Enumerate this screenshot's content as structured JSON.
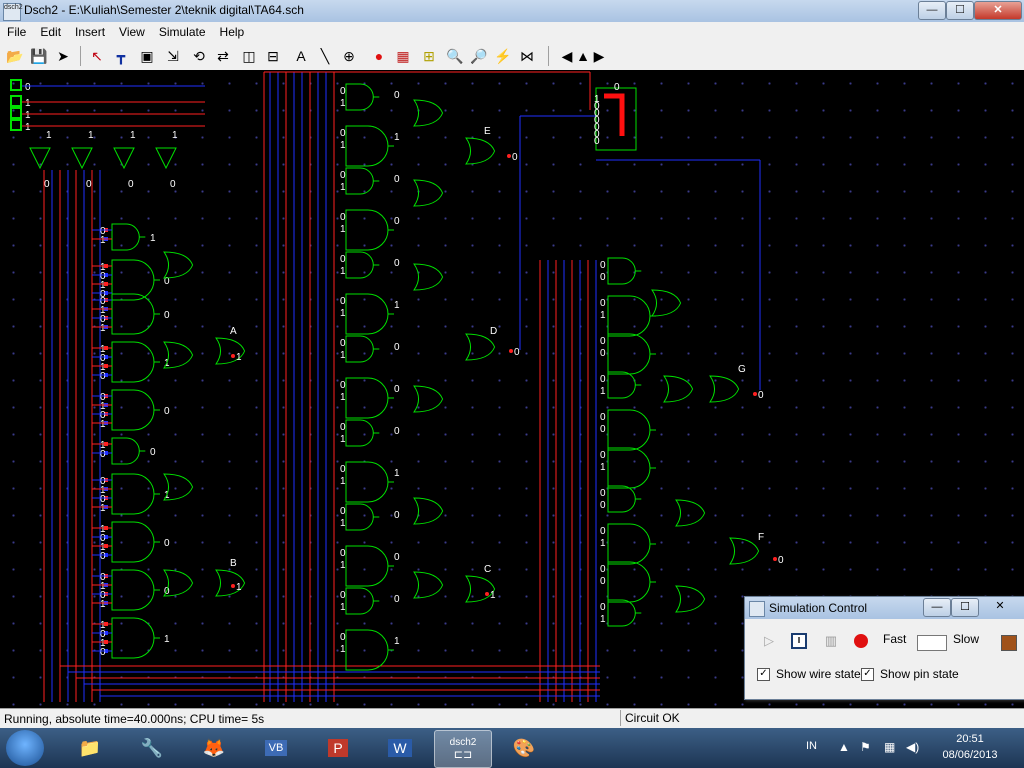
{
  "window": {
    "app_icon_text": "dsch2",
    "title": "Dsch2 - E:\\Kuliah\\Semester 2\\teknik digital\\TA64.sch",
    "min_label": "—",
    "max_label": "☐",
    "close_label": "✕"
  },
  "menu": [
    "File",
    "Edit",
    "Insert",
    "View",
    "Simulate",
    "Help"
  ],
  "toolbar": [
    {
      "icon": "open-folder-icon",
      "glyph": "📂"
    },
    {
      "icon": "save-icon",
      "glyph": "💾"
    },
    {
      "icon": "run-icon",
      "glyph": "➤"
    },
    {
      "icon": "select-arrow-icon",
      "glyph": "↖"
    },
    {
      "icon": "wire-tool-icon",
      "glyph": "┳"
    },
    {
      "icon": "box-icon",
      "glyph": "▣"
    },
    {
      "icon": "move-icon",
      "glyph": "⇲"
    },
    {
      "icon": "rotate-icon",
      "glyph": "⟲"
    },
    {
      "icon": "flip-icon",
      "glyph": "⇄"
    },
    {
      "icon": "mirror-h-icon",
      "glyph": "◫"
    },
    {
      "icon": "mirror-v-icon",
      "glyph": "⊟"
    },
    {
      "icon": "text-icon",
      "glyph": "A"
    },
    {
      "icon": "line-icon",
      "glyph": "╲"
    },
    {
      "icon": "connect-icon",
      "glyph": "⊕"
    },
    {
      "icon": "record-icon",
      "glyph": "●"
    },
    {
      "icon": "chip-icon",
      "glyph": "▦"
    },
    {
      "icon": "timing-icon",
      "glyph": "⊞"
    },
    {
      "icon": "zoom-in-icon",
      "glyph": "🔍"
    },
    {
      "icon": "zoom-out-icon",
      "glyph": "🔎"
    },
    {
      "icon": "probe-icon",
      "glyph": "⚡"
    },
    {
      "icon": "network-icon",
      "glyph": "⋈"
    },
    {
      "icon": "scroll-left-icon",
      "glyph": "◀"
    },
    {
      "icon": "scroll-up-icon",
      "glyph": "▲"
    },
    {
      "icon": "scroll-right-icon",
      "glyph": "▶"
    }
  ],
  "circuit": {
    "inputs": [
      "0",
      "1",
      "1",
      "1"
    ],
    "outputs": [
      {
        "label": "A",
        "value": "1"
      },
      {
        "label": "B",
        "value": "1"
      },
      {
        "label": "C",
        "value": "1"
      },
      {
        "label": "D",
        "value": "0"
      },
      {
        "label": "E",
        "value": "0"
      },
      {
        "label": "F",
        "value": "0"
      },
      {
        "label": "G",
        "value": "0"
      }
    ],
    "display_value": "0"
  },
  "status": {
    "left": "Running, absolute time=40.000ns; CPU time= 5s",
    "right": "Circuit OK"
  },
  "sim_control": {
    "title": "Simulation Control",
    "fast_label": "Fast",
    "slow_label": "Slow",
    "show_wire_state": "Show wire state",
    "show_pin_state": "Show pin state"
  },
  "taskbar": {
    "apps": [
      "explorer",
      "app-orange",
      "firefox",
      "vb",
      "powerpoint",
      "word",
      "dsch2",
      "paint"
    ],
    "active_label": "dsch2",
    "language": "IN",
    "time": "20:51",
    "date": "08/06/2013"
  },
  "colors": {
    "wire_logic1": "#ff2020",
    "wire_logic0": "#2030ff",
    "gate": "#00e000",
    "background": "#000000",
    "pin": "#00a0a0"
  }
}
